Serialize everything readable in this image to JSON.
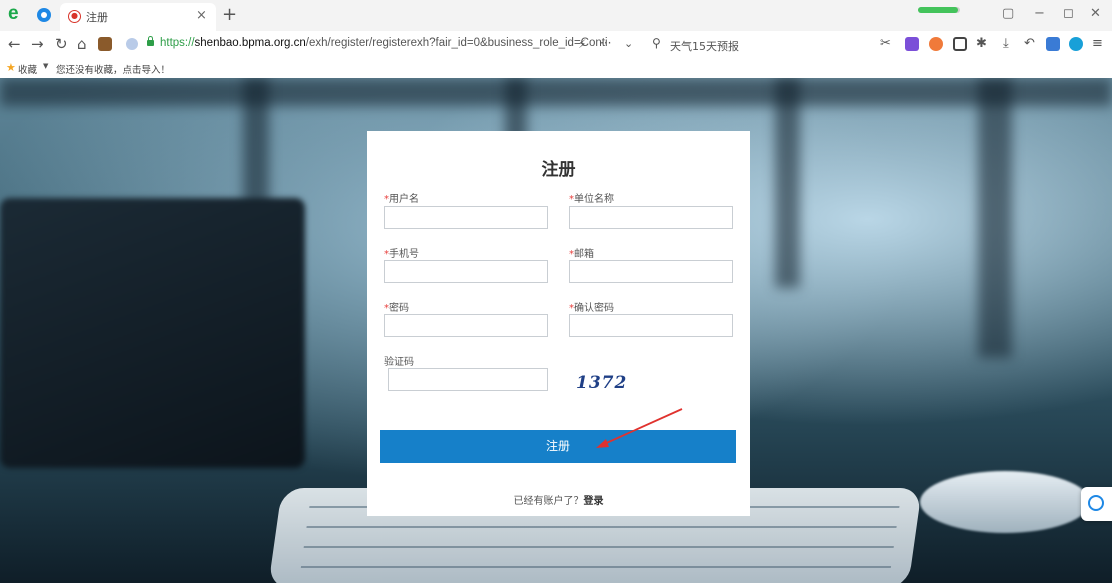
{
  "browser": {
    "tab_title": "注册",
    "tab_close": "×",
    "new_tab": "+",
    "load_progress": 0.95,
    "url_protocol": "https://",
    "url_host": "shenbao.bpma.org.cn",
    "url_path": "/exh/register/registerexh?fair_id=0&business_role_id=Conti",
    "search_text": "天气15天预报",
    "bookmarks_label": "收藏",
    "bookmarks_hint": "您还没有收藏，点击导入！",
    "colors": {
      "secure": "#2e9e48",
      "accent": "#1e88e5",
      "bookmark_star": "#f5a623"
    }
  },
  "form": {
    "title": "注册",
    "required_mark": "*",
    "username_label": "用户名",
    "company_label": "单位名称",
    "phone_label": "手机号",
    "email_label": "邮箱",
    "password_label": "密码",
    "confirm_password_label": "确认密码",
    "captcha_label": "验证码",
    "captcha_code": "1372",
    "submit_label": "注册",
    "login_prompt": "已经有账户了？",
    "login_link": "登录",
    "colors": {
      "button": "#1680c9",
      "required": "#e8413e",
      "captcha_text": "#1f3f86"
    }
  }
}
